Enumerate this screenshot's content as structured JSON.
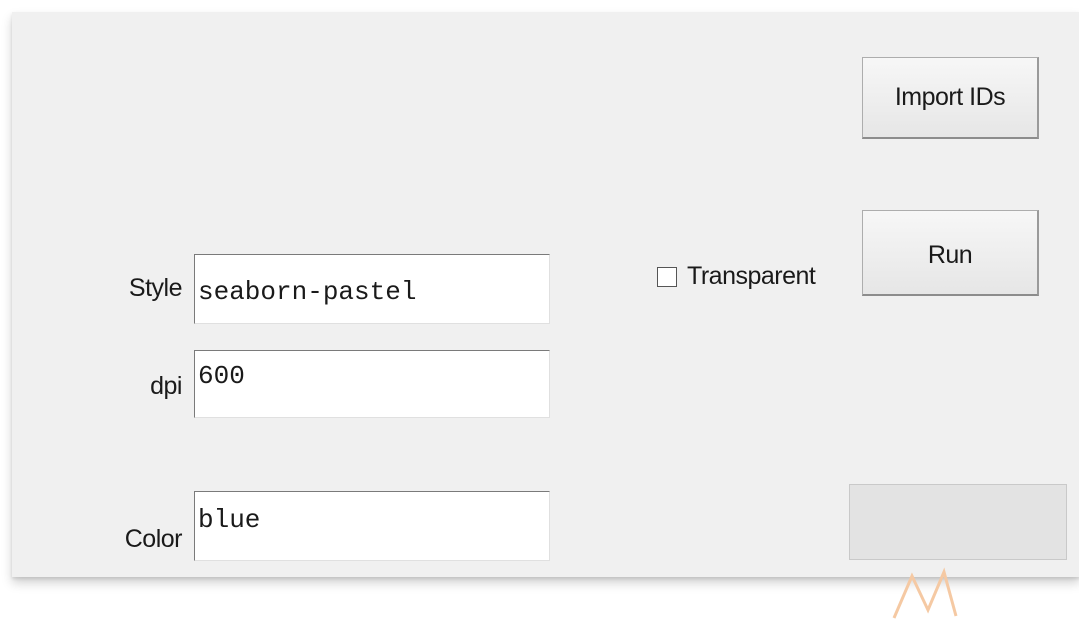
{
  "buttons": {
    "import_label": "Import IDs",
    "run_label": "Run"
  },
  "fields": {
    "style": {
      "label": "Style",
      "value": "seaborn-pastel"
    },
    "dpi": {
      "label": "dpi",
      "value": "600"
    },
    "color": {
      "label": "Color",
      "value": "blue"
    }
  },
  "options": {
    "transparent_label": "Transparent",
    "transparent_checked": false
  },
  "colors": {
    "window_bg": "#f0f0f0",
    "watermark": "#f5c9a3"
  }
}
